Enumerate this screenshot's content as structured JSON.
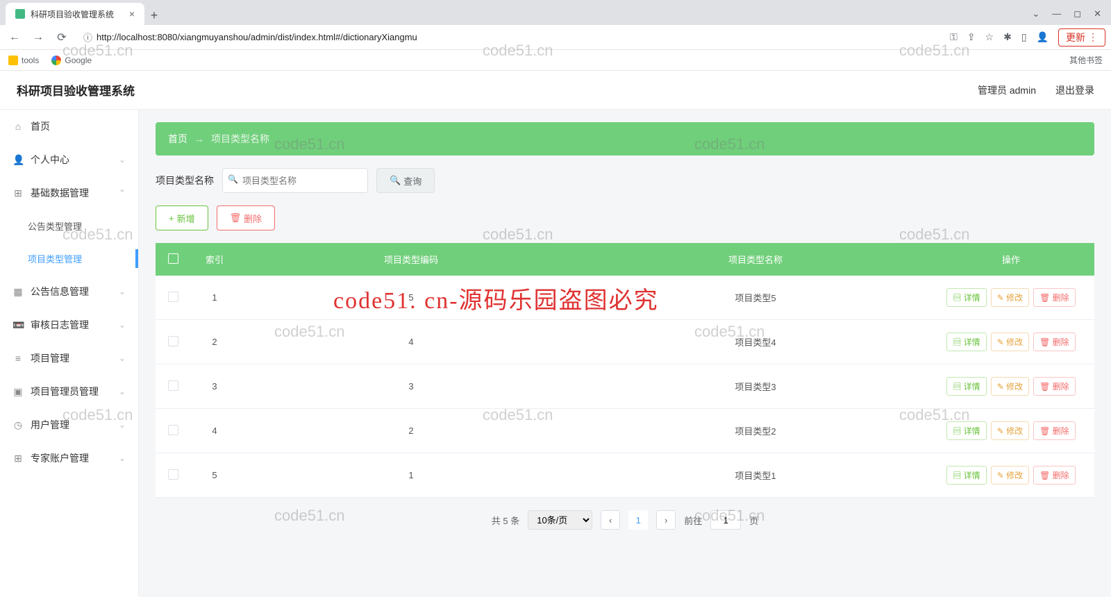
{
  "browser": {
    "tab_title": "科研项目验收管理系统",
    "url": "http://localhost:8080/xiangmuyanshou/admin/dist/index.html#/dictionaryXiangmu",
    "bm_tools": "tools",
    "bm_google": "Google",
    "bm_other": "其他书签",
    "update": "更新"
  },
  "header": {
    "title": "科研项目验收管理系统",
    "user": "管理员 admin",
    "logout": "退出登录"
  },
  "sidebar": {
    "items": [
      {
        "icon": "⌂",
        "label": "首页",
        "arrow": ""
      },
      {
        "icon": "👤",
        "label": "个人中心",
        "arrow": "⌄"
      },
      {
        "icon": "⊞",
        "label": "基础数据管理",
        "arrow": "⌃"
      },
      {
        "icon": "▦",
        "label": "公告信息管理",
        "arrow": "⌄"
      },
      {
        "icon": "📼",
        "label": "审核日志管理",
        "arrow": "⌄"
      },
      {
        "icon": "≡",
        "label": "项目管理",
        "arrow": "⌄"
      },
      {
        "icon": "▣",
        "label": "项目管理员管理",
        "arrow": "⌄"
      },
      {
        "icon": "◷",
        "label": "用户管理",
        "arrow": "⌄"
      },
      {
        "icon": "⊞",
        "label": "专家账户管理",
        "arrow": "⌄"
      }
    ],
    "sub": [
      {
        "label": "公告类型管理",
        "active": false
      },
      {
        "label": "项目类型管理",
        "active": true
      }
    ]
  },
  "crumb": {
    "home": "首页",
    "sep": "→",
    "cur": "项目类型名称"
  },
  "search": {
    "label": "项目类型名称",
    "placeholder": "项目类型名称",
    "btn": "查询"
  },
  "actions": {
    "add": "新增",
    "del": "删除"
  },
  "table": {
    "cols": [
      "",
      "索引",
      "项目类型编码",
      "项目类型名称",
      "操作"
    ],
    "ops": {
      "detail": "详情",
      "edit": "修改",
      "del": "删除"
    },
    "rows": [
      {
        "idx": "1",
        "code": "5",
        "name": "项目类型5"
      },
      {
        "idx": "2",
        "code": "4",
        "name": "项目类型4"
      },
      {
        "idx": "3",
        "code": "3",
        "name": "项目类型3"
      },
      {
        "idx": "4",
        "code": "2",
        "name": "项目类型2"
      },
      {
        "idx": "5",
        "code": "1",
        "name": "项目类型1"
      }
    ]
  },
  "pager": {
    "total": "共 5 条",
    "size": "10条/页",
    "cur": "1",
    "goto": "前往",
    "goto_val": "1",
    "goto_suffix": "页"
  },
  "watermark": "code51.cn",
  "watermark_red": "code51. cn-源码乐园盗图必究"
}
